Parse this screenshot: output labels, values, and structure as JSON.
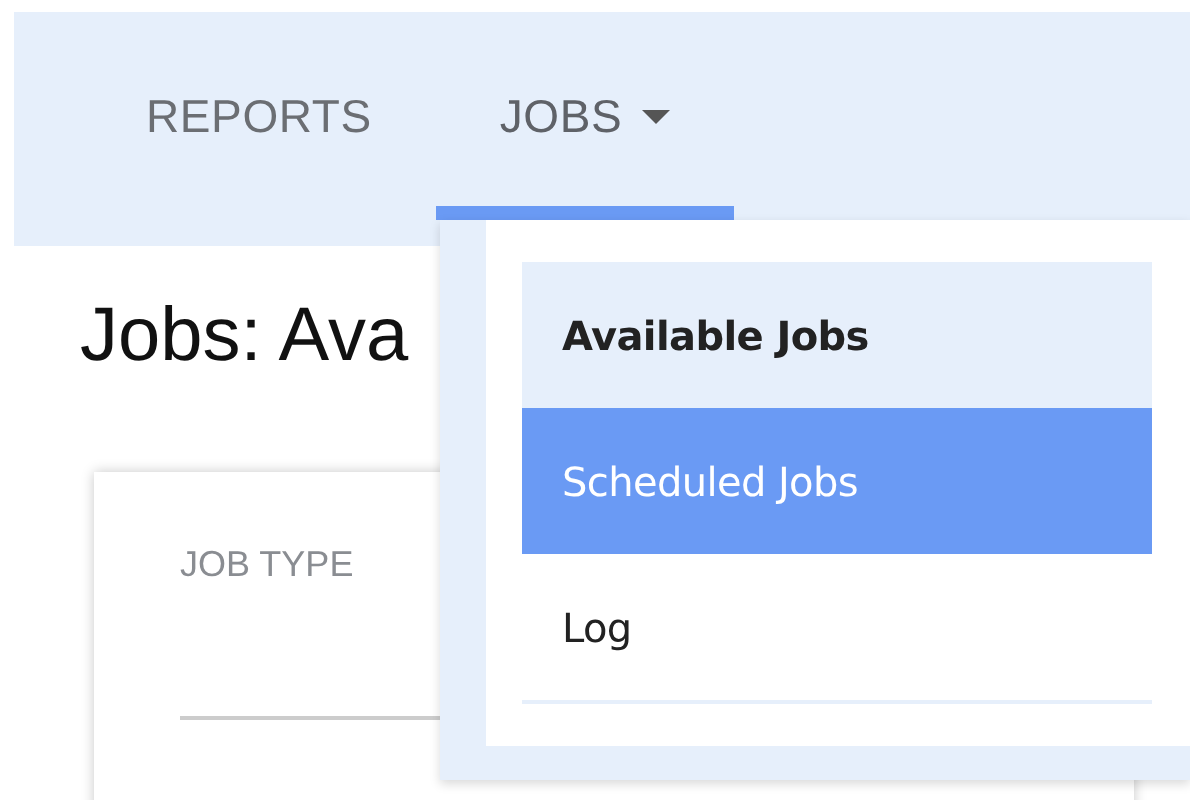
{
  "nav": {
    "tabs": [
      {
        "label": "REPORTS",
        "kind": "link",
        "selected": false
      },
      {
        "label": "JOBS",
        "kind": "dropdown",
        "selected": true
      }
    ]
  },
  "dropdown": {
    "items": [
      {
        "label": "Available Jobs",
        "current": true,
        "highlighted": false
      },
      {
        "label": "Scheduled Jobs",
        "current": false,
        "highlighted": true
      },
      {
        "label": "Log",
        "current": false,
        "highlighted": false
      }
    ]
  },
  "page": {
    "heading": "Jobs: Ava",
    "card": {
      "field_label": "JOB TYPE"
    }
  }
}
